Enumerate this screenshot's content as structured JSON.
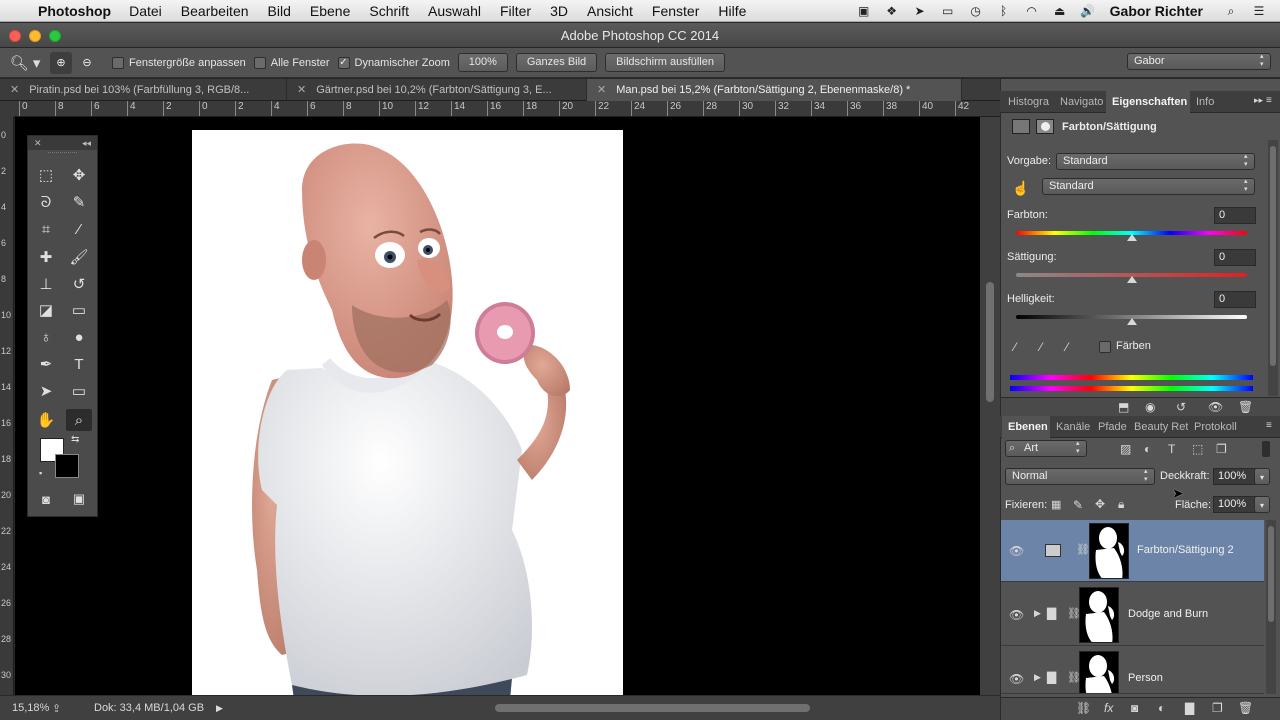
{
  "menubar": {
    "app": "Photoshop",
    "items": [
      "Datei",
      "Bearbeiten",
      "Bild",
      "Ebene",
      "Schrift",
      "Auswahl",
      "Filter",
      "3D",
      "Ansicht",
      "Fenster",
      "Hilfe"
    ],
    "user": "Gabor Richter"
  },
  "window": {
    "title": "Adobe Photoshop CC 2014"
  },
  "options": {
    "fit_window": "Fenstergröße anpassen",
    "all_windows": "Alle Fenster",
    "dynamic_zoom": "Dynamischer Zoom",
    "zoom_value": "100%",
    "whole_image": "Ganzes Bild",
    "fill_screen": "Bildschirm ausfüllen",
    "workspace": "Gabor"
  },
  "tabs": [
    {
      "label": "Piratin.psd bei 103% (Farbfüllung 3, RGB/8..."
    },
    {
      "label": "Gärtner.psd bei 10,2% (Farbton/Sättigung 3, E..."
    },
    {
      "label": "Man.psd bei 15,2% (Farbton/Sättigung 2, Ebenenmaske/8) *"
    }
  ],
  "ruler": {
    "h": [
      "0",
      "8",
      "6",
      "4",
      "2",
      "0",
      "2",
      "4",
      "6",
      "8",
      "10",
      "12",
      "14",
      "16",
      "18",
      "20",
      "22",
      "24",
      "26",
      "28",
      "30",
      "32",
      "34",
      "36",
      "38",
      "40",
      "42"
    ],
    "v": [
      "0",
      "2",
      "4",
      "6",
      "8",
      "10",
      "12",
      "14",
      "16",
      "18",
      "20",
      "22",
      "24",
      "26",
      "28",
      "30"
    ]
  },
  "status": {
    "zoom": "15,18%",
    "doc": "Dok: 33,4 MB/1,04 GB"
  },
  "properties": {
    "tabs": [
      "Histogra",
      "Navigato",
      "Eigenschaften",
      "Info"
    ],
    "title": "Farbton/Sättigung",
    "preset_label": "Vorgabe:",
    "preset_value": "Standard",
    "channel_value": "Standard",
    "hue_label": "Farbton:",
    "hue_value": "0",
    "sat_label": "Sättigung:",
    "sat_value": "0",
    "light_label": "Helligkeit:",
    "light_value": "0",
    "colorize_label": "Färben"
  },
  "layers": {
    "tabs": [
      "Ebenen",
      "Kanäle",
      "Pfade",
      "Beauty Ret",
      "Protokoll"
    ],
    "filter": "Art",
    "blend": "Normal",
    "opacity_label": "Deckkraft:",
    "opacity_value": "100%",
    "lock_label": "Fixieren:",
    "fill_label": "Fläche:",
    "fill_value": "100%",
    "items": [
      {
        "name": "Farbton/Sättigung 2"
      },
      {
        "name": "Dodge and Burn"
      },
      {
        "name": "Person"
      }
    ]
  }
}
